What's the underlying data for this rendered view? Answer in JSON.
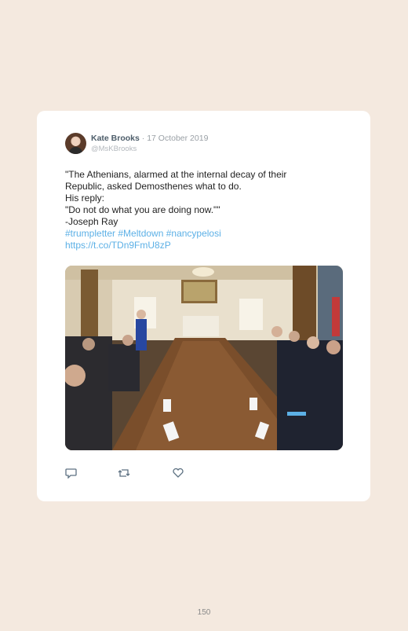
{
  "tweet": {
    "author_name": "Kate Brooks",
    "date": " · 17 October 2019",
    "handle": "@MsKBrooks",
    "lines": [
      "\"The Athenians, alarmed at the internal decay of their",
      "Republic, asked Demosthenes what to do.",
      "His reply:",
      "\"Do not do what you are doing now.\"\"",
      "-Joseph Ray"
    ],
    "hashtags": "#trumpletter #Meltdown #nancypelosi",
    "link": "https://t.co/TDn9FmU8zP",
    "icons": [
      "reply-icon",
      "retweet-icon",
      "like-icon"
    ]
  },
  "page_number": "150"
}
